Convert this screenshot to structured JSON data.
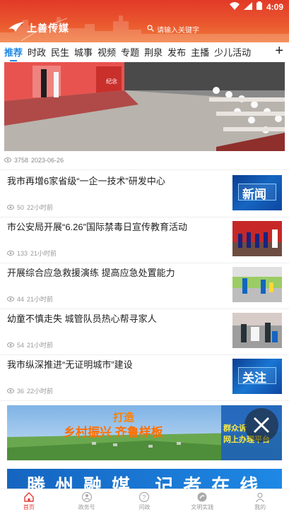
{
  "status_bar": {
    "time": "4:09"
  },
  "header": {
    "brand": "上善传媒",
    "search_placeholder": "请输入关键字"
  },
  "tabs": [
    {
      "label": "推荐",
      "active": true
    },
    {
      "label": "时政"
    },
    {
      "label": "民生"
    },
    {
      "label": "城事"
    },
    {
      "label": "视频"
    },
    {
      "label": "专题"
    },
    {
      "label": "荆泉"
    },
    {
      "label": "发布"
    },
    {
      "label": "主播"
    },
    {
      "label": "少儿活动"
    }
  ],
  "hero": {
    "views": "3758",
    "date": "2023-06-26",
    "stage_text": "纪念"
  },
  "news": [
    {
      "title": "我市再增6家省级“一企一技术”研发中心",
      "views": "50",
      "time": "22小时前",
      "thumb_text": "新闻"
    },
    {
      "title": "市公安局开展“6.26”国际禁毒日宣传教育活动",
      "views": "133",
      "time": "21小时前"
    },
    {
      "title": "开展综合应急救援演练  提高应急处置能力",
      "views": "44",
      "time": "21小时前"
    },
    {
      "title": "幼童不慎走失  城管队员热心帮寻家人",
      "views": "54",
      "time": "21小时前"
    },
    {
      "title": "我市纵深推进“无证明城市”建设",
      "views": "36",
      "time": "22小时前",
      "thumb_text": "关注"
    }
  ],
  "banner1": {
    "line1": "打造",
    "line2": "乡村振兴  齐鲁样板",
    "side_line1": "群众诉",
    "side_line2": "网上办理平台"
  },
  "banner2": {
    "text": "滕州融媒  记者在线"
  },
  "bottom_nav": [
    {
      "label": "首页",
      "active": true
    },
    {
      "label": "政务号"
    },
    {
      "label": "问政"
    },
    {
      "label": "文明实践"
    },
    {
      "label": "我的"
    }
  ],
  "colors": {
    "brand_red": "#e53935",
    "tab_active": "#1e88e5",
    "header_top": "#e23a28"
  }
}
